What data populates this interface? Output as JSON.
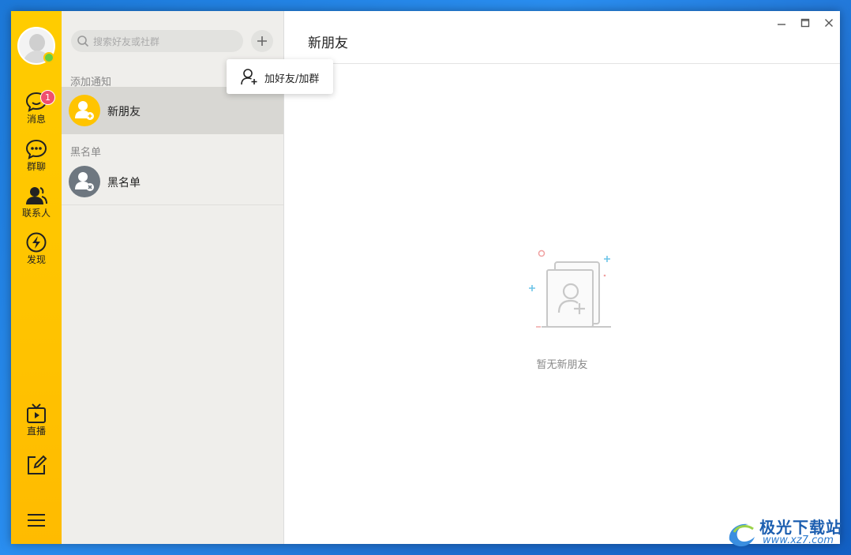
{
  "colors": {
    "accent": "#ffc400",
    "badge": "#f0506e",
    "online": "#66cc44",
    "selected_row": "#d8d7d3"
  },
  "nav": {
    "items": [
      {
        "label": "消息",
        "icon": "message-icon",
        "badge": "1"
      },
      {
        "label": "群聊",
        "icon": "group-chat-icon"
      },
      {
        "label": "联系人",
        "icon": "contacts-icon"
      },
      {
        "label": "发现",
        "icon": "discover-icon"
      },
      {
        "label": "直播",
        "icon": "live-tv-icon"
      }
    ],
    "bottom_icons": [
      "edit-icon",
      "menu-icon"
    ]
  },
  "search": {
    "placeholder": "搜索好友或社群"
  },
  "popup": {
    "label": "加好友/加群"
  },
  "sections": {
    "add_notice": {
      "header": "添加通知",
      "item": "新朋友"
    },
    "blacklist": {
      "header": "黑名单",
      "item": "黑名单"
    }
  },
  "main": {
    "title": "新朋友",
    "empty_text": "暂无新朋友",
    "window_controls": [
      "minimize-icon",
      "maximize-icon",
      "close-icon"
    ]
  },
  "watermark": {
    "name": "极光下载站",
    "url": "www.xz7.com"
  }
}
